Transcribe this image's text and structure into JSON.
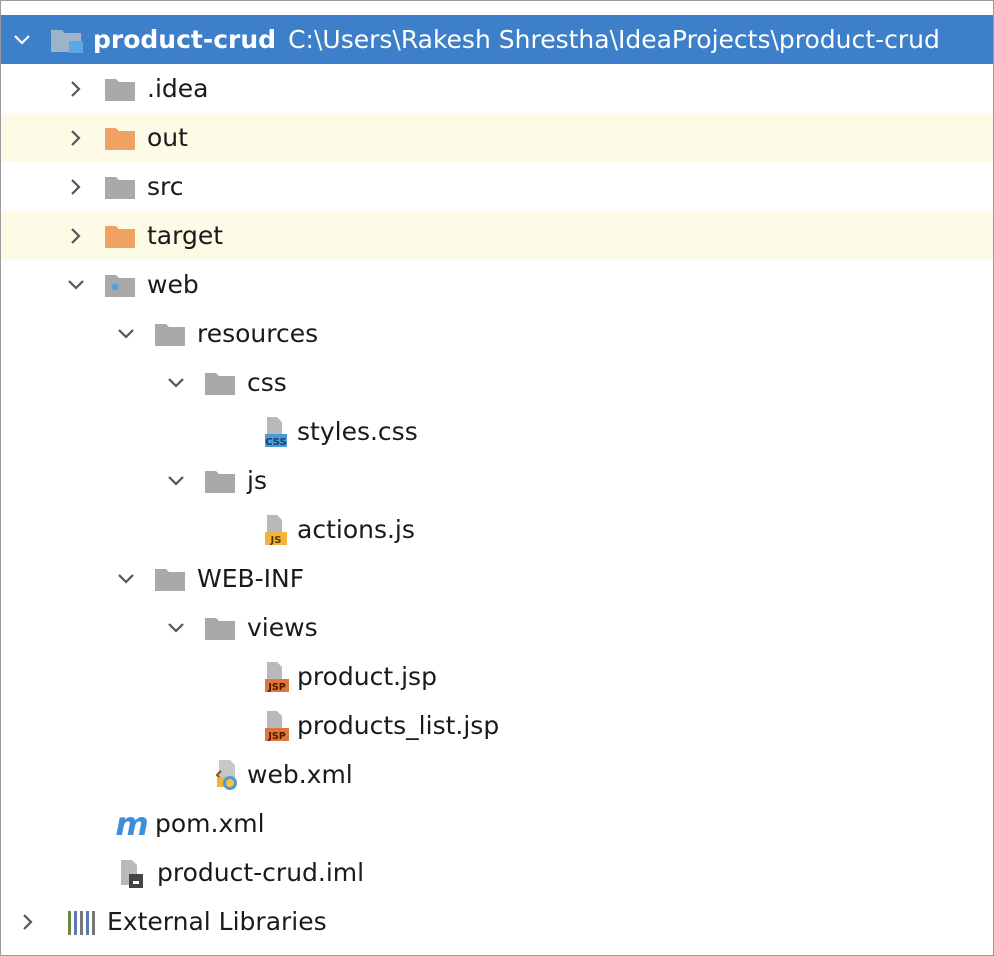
{
  "colors": {
    "selection": "#3d7fc8",
    "excluded_row": "#fdfbe6",
    "folder_gray": "#a9a9a9",
    "folder_orange": "#f0a264",
    "css_badge": "#4a9bd8",
    "js_badge": "#f0b53c",
    "jsp_badge": "#e0763a"
  },
  "tree": {
    "root": {
      "name": "product-crud",
      "path": "C:\\Users\\Rakesh Shrestha\\IdeaProjects\\product-crud",
      "icon": "module-folder-icon"
    },
    "idea": {
      "label": ".idea",
      "icon": "folder-icon"
    },
    "out": {
      "label": "out",
      "icon": "excluded-folder-icon"
    },
    "src": {
      "label": "src",
      "icon": "folder-icon"
    },
    "target": {
      "label": "target",
      "icon": "excluded-folder-icon"
    },
    "web": {
      "label": "web",
      "icon": "web-folder-icon"
    },
    "resources": {
      "label": "resources",
      "icon": "folder-icon"
    },
    "css": {
      "label": "css",
      "icon": "folder-icon"
    },
    "styles_css": {
      "label": "styles.css",
      "icon": "css-file-icon",
      "badge": "CSS"
    },
    "js": {
      "label": "js",
      "icon": "folder-icon"
    },
    "actions_js": {
      "label": "actions.js",
      "icon": "js-file-icon",
      "badge": "JS"
    },
    "web_inf": {
      "label": "WEB-INF",
      "icon": "folder-icon"
    },
    "views": {
      "label": "views",
      "icon": "folder-icon"
    },
    "product_jsp": {
      "label": "product.jsp",
      "icon": "jsp-file-icon",
      "badge": "JSP"
    },
    "products_list_jsp": {
      "label": "products_list.jsp",
      "icon": "jsp-file-icon",
      "badge": "JSP"
    },
    "web_xml": {
      "label": "web.xml",
      "icon": "web-xml-file-icon"
    },
    "pom_xml": {
      "label": "pom.xml",
      "icon": "maven-icon",
      "glyph": "m"
    },
    "iml": {
      "label": "product-crud.iml",
      "icon": "iml-file-icon"
    },
    "external_libraries": {
      "label": "External Libraries",
      "icon": "library-icon"
    }
  }
}
